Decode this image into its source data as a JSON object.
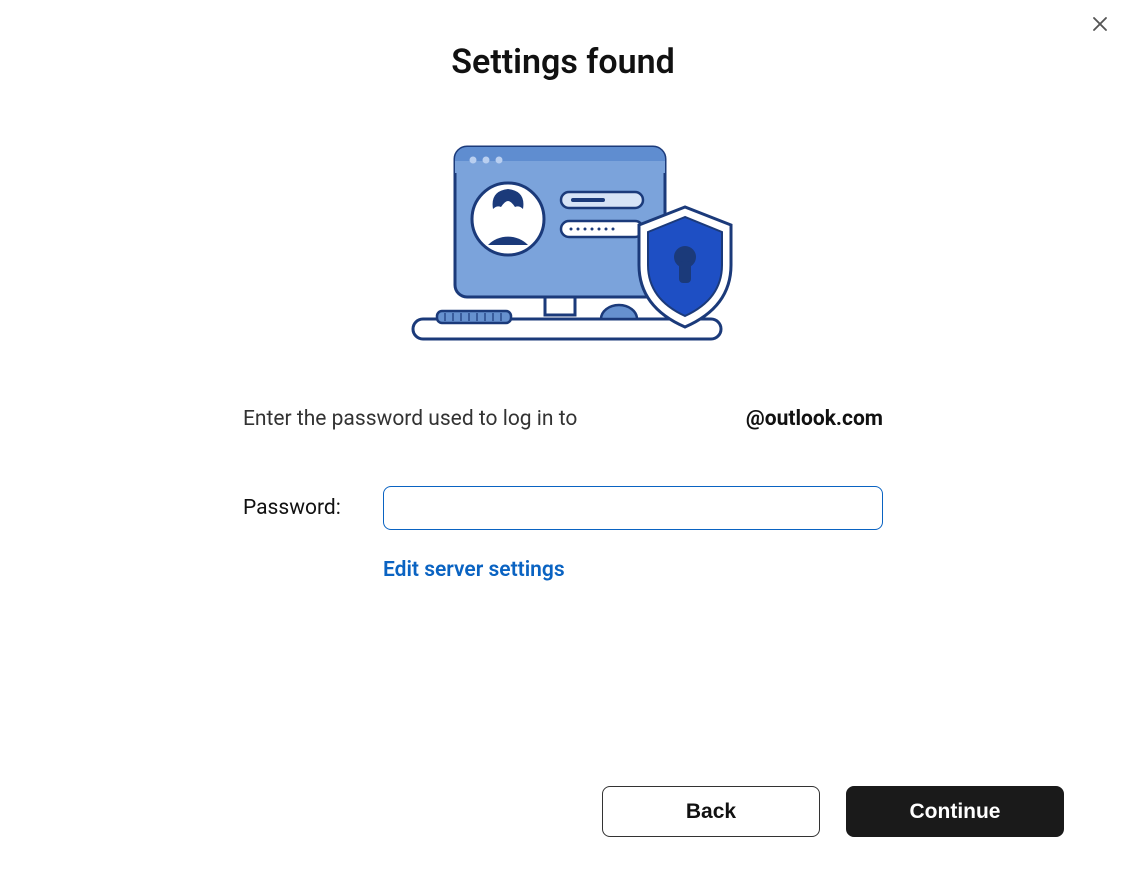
{
  "dialog": {
    "title": "Settings found",
    "instruction_prefix": "Enter the password used to log in to",
    "email_display": "@outlook.com",
    "password_label": "Password:",
    "password_value": "",
    "edit_link": "Edit server settings",
    "back_label": "Back",
    "continue_label": "Continue"
  }
}
